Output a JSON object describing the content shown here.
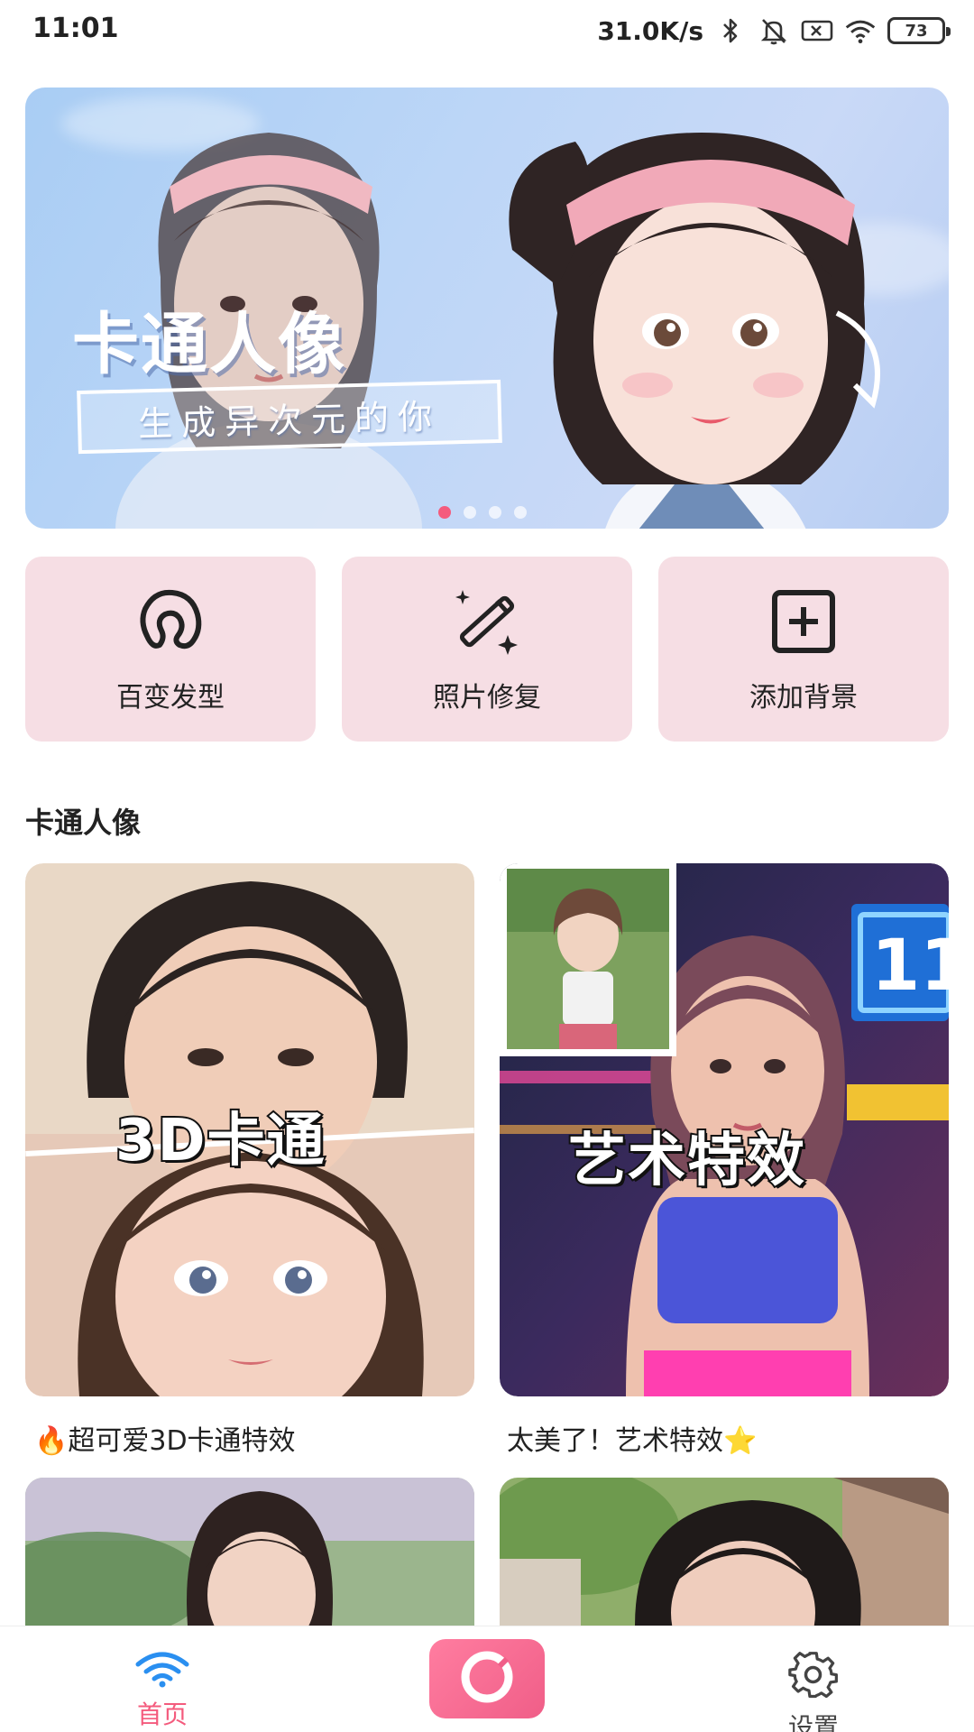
{
  "status_bar": {
    "time": "11:01",
    "net_speed": "31.0K/s",
    "battery": "73",
    "icons": [
      "bluetooth-icon",
      "mute-icon",
      "sim-off-icon",
      "wifi-icon",
      "battery-icon"
    ]
  },
  "banner": {
    "title": "卡通人像",
    "subtitle": "生成异次元的你",
    "page_count": 4,
    "active_index": 0
  },
  "features": [
    {
      "label": "百变发型",
      "icon": "hairstyle-icon"
    },
    {
      "label": "照片修复",
      "icon": "magic-wand-icon"
    },
    {
      "label": "添加背景",
      "icon": "add-square-icon"
    }
  ],
  "section": {
    "title": "卡通人像"
  },
  "cards": [
    {
      "overlay": "3D卡通",
      "caption": "🔥超可爱3D卡通特效"
    },
    {
      "overlay": "艺术特效",
      "caption": "太美了！艺术特效⭐"
    }
  ],
  "sign_number": "11",
  "bottom_nav": {
    "home_label": "首页",
    "settings_label": "设置"
  },
  "colors": {
    "accent": "#f45b7d",
    "tile_bg": "#f6dee4",
    "banner_bg": "#b8d2f5"
  }
}
